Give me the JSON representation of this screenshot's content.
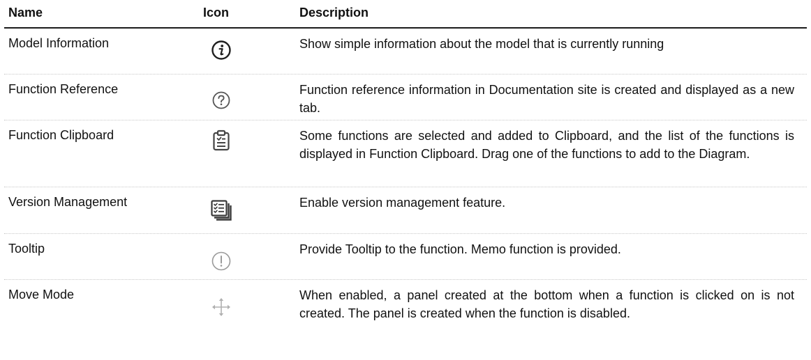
{
  "headers": {
    "name": "Name",
    "icon": "Icon",
    "description": "Description"
  },
  "rows": [
    {
      "name": "Model Information",
      "icon": "info-icon",
      "description": "Show simple information about the model that is currently running"
    },
    {
      "name": "Function Reference",
      "icon": "question-circle-icon",
      "description": "Function reference information in Documentation site is created and displayed as a new tab."
    },
    {
      "name": "Function Clipboard",
      "icon": "clipboard-icon",
      "description": "Some functions are selected and added to Clipboard, and the list of the functions is displayed in Function Clipboard. Drag one of the functions to add to the Diagram."
    },
    {
      "name": "Version Management",
      "icon": "version-list-icon",
      "description": "Enable version management feature."
    },
    {
      "name": "Tooltip",
      "icon": "exclamation-circle-icon",
      "description": "Provide Tooltip to the function. Memo function is provided."
    },
    {
      "name": "Move Mode",
      "icon": "move-arrows-icon",
      "description": "When enabled, a panel created at the bottom when a function is clicked on is not created. The panel is created when the function is disabled."
    }
  ]
}
